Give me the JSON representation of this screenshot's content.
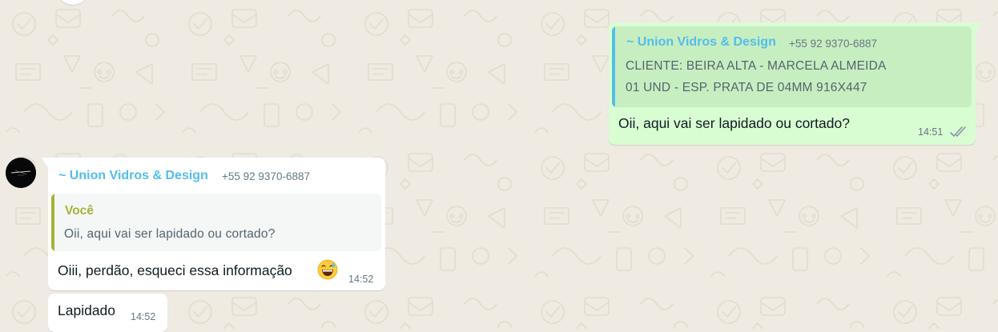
{
  "chat": {
    "outgoing": {
      "quote": {
        "sender": "~ Union Vidros & Design",
        "phone": "+55 92 9370-6887",
        "line1": "CLIENTE: BEIRA ALTA - MARCELA ALMEIDA",
        "line2": "01 UND - ESP. PRATA DE 04MM 916X447"
      },
      "text": "Oii, aqui vai ser lapidado ou cortado?",
      "time": "14:51",
      "status_icon": "double-check-icon"
    },
    "incoming": [
      {
        "sender": "~ Union Vidros & Design",
        "phone": "+55 92 9370-6887",
        "quote": {
          "sender": "Você",
          "text": "Oii, aqui vai ser lapidado ou cortado?"
        },
        "text": "Oiii, perdão, esqueci essa informação",
        "emoji": "grinning-sweat-emoji",
        "time": "14:52"
      },
      {
        "text": "Lapidado",
        "time": "14:52"
      }
    ]
  },
  "colors": {
    "background": "#efeae2",
    "outgoing_bubble": "#d9fdd3",
    "incoming_bubble": "#ffffff",
    "sender_name": "#53bdeb",
    "you_name": "#a5b337",
    "quote_bar_out": "#53bdeb",
    "quote_bar_in": "#a5b337"
  }
}
